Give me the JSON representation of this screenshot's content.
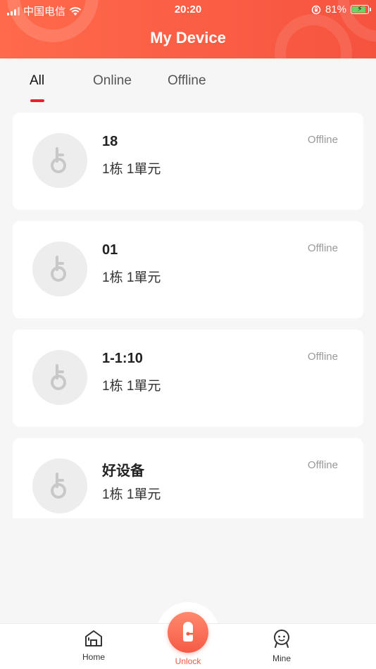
{
  "status_bar": {
    "carrier": "中国电信",
    "time": "20:20",
    "battery": "81%",
    "battery_level": 0.81
  },
  "header": {
    "title": "My Device"
  },
  "tabs": [
    {
      "label": "All",
      "active": true
    },
    {
      "label": "Online",
      "active": false
    },
    {
      "label": "Offline",
      "active": false
    }
  ],
  "devices": [
    {
      "name": "18",
      "location": "1栋 1單元",
      "status": "Offline"
    },
    {
      "name": "01",
      "location": "1栋 1單元",
      "status": "Offline"
    },
    {
      "name": "1-1:10",
      "location": "1栋 1單元",
      "status": "Offline"
    },
    {
      "name": "好设备",
      "location": "1栋 1單元",
      "status": "Offline"
    }
  ],
  "bottom_nav": {
    "home": "Home",
    "unlock": "Unlock",
    "mine": "Mine"
  },
  "colors": {
    "accent": "#f6533f",
    "tab_indicator": "#e8202f",
    "muted_text": "#999999"
  },
  "icons": {
    "device": "lock-icon",
    "home": "home-icon",
    "unlock": "unlock-icon",
    "mine": "profile-icon"
  }
}
